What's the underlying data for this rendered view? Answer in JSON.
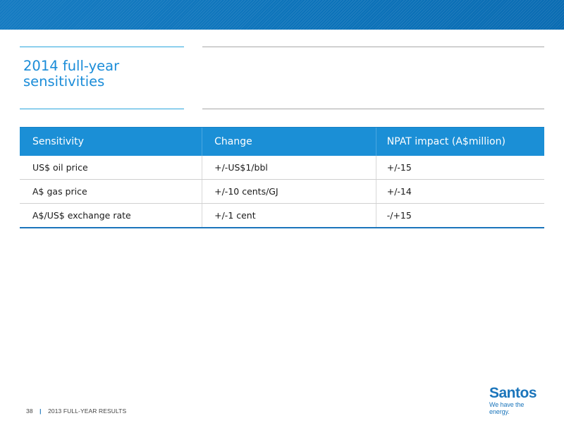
{
  "slide": {
    "title": "2014 full-year\nsensitivities"
  },
  "table": {
    "headers": [
      "Sensitivity",
      "Change",
      "NPAT impact (A$million)"
    ],
    "rows": [
      [
        "US$ oil price",
        "+/-US$1/bbl",
        "+/-15"
      ],
      [
        "A$ gas price",
        "+/-10 cents/GJ",
        "+/-14"
      ],
      [
        "A$/US$ exchange rate",
        "+/-1 cent",
        "-/+15"
      ]
    ]
  },
  "footer": {
    "page_number": "38",
    "separator": "|",
    "label": "2013 FULL-YEAR RESULTS"
  },
  "logo": {
    "name": "Santos",
    "tagline": "We have the energy."
  },
  "colors": {
    "brand_blue": "#1b75bb",
    "header_blue": "#1b8fd6",
    "title_blue": "#1a8cd8"
  }
}
